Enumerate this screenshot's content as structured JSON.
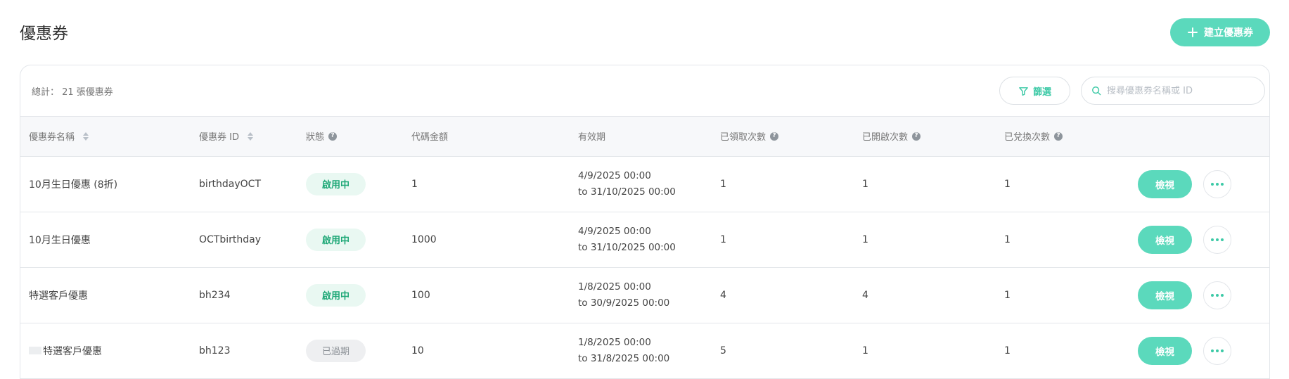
{
  "header": {
    "title": "優惠券",
    "create_button_label": "建立優惠券"
  },
  "toolbar": {
    "total_label": "總計： 21 張優惠券",
    "filter_label": "篩選",
    "search_placeholder": "搜尋優惠券名稱或 ID"
  },
  "table": {
    "columns": [
      "優惠券名稱",
      "優惠券 ID",
      "狀態",
      "代碼金額",
      "有效期",
      "已領取次數",
      "已開啟次數",
      "已兌換次數"
    ],
    "rows": [
      {
        "name": "10月生日優惠 (8折)",
        "id": "birthdayOCT",
        "status": "啟用中",
        "status_type": "active",
        "amount": "1",
        "valid_from": "4/9/2025 00:00",
        "valid_to": "to 31/10/2025 00:00",
        "claimed": "1",
        "opened": "1",
        "redeemed": "1",
        "view_label": "檢視"
      },
      {
        "name": "10月生日優惠",
        "id": "OCTbirthday",
        "status": "啟用中",
        "status_type": "active",
        "amount": "1000",
        "valid_from": "4/9/2025 00:00",
        "valid_to": "to 31/10/2025 00:00",
        "claimed": "1",
        "opened": "1",
        "redeemed": "1",
        "view_label": "檢視"
      },
      {
        "name": "特選客戶優惠",
        "id": "bh234",
        "status": "啟用中",
        "status_type": "active",
        "amount": "100",
        "valid_from": "1/8/2025 00:00",
        "valid_to": "to 30/9/2025 00:00",
        "claimed": "4",
        "opened": "4",
        "redeemed": "1",
        "view_label": "檢視"
      },
      {
        "name": "特選客戶優惠",
        "id": "bh123",
        "status": "已過期",
        "status_type": "expired",
        "amount": "10",
        "valid_from": "1/8/2025 00:00",
        "valid_to": "to 31/8/2025 00:00",
        "claimed": "5",
        "opened": "1",
        "redeemed": "1",
        "view_label": "檢視"
      }
    ]
  },
  "colors": {
    "accent": "#5bd9bc",
    "accent_text": "#3cc9a6",
    "active_bg": "#e9f8f2",
    "active_text": "#1ea877",
    "expired_bg": "#eeeff1",
    "expired_text": "#8c9197"
  },
  "icons": {
    "create": "plus-icon",
    "filter": "funnel-icon",
    "search": "search-icon",
    "sort": "sort-icon",
    "help": "question-circle-icon",
    "more": "more-dots-icon"
  }
}
